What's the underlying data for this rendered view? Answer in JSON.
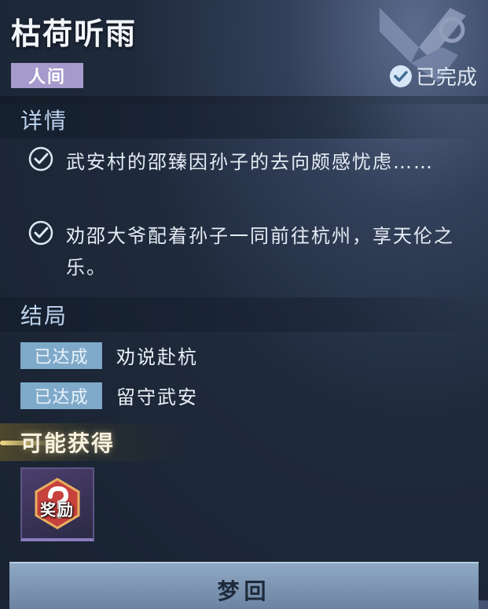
{
  "header": {
    "title": "枯荷听雨",
    "realm_tag": "人间",
    "status_label": "已完成"
  },
  "details": {
    "heading": "详情",
    "items": [
      {
        "text": "武安村的邵臻因孙子的去向颇感忧虑……",
        "completed": true
      },
      {
        "text": "劝邵大爷配着孙子一同前往杭州，享天伦之乐。",
        "completed": true
      }
    ]
  },
  "endings": {
    "heading": "结局",
    "items": [
      {
        "badge": "已达成",
        "text": "劝说赴杭"
      },
      {
        "badge": "已达成",
        "text": "留守武安"
      }
    ]
  },
  "rewards": {
    "heading": "可能获得",
    "items": [
      {
        "label": "奖励",
        "icon": "mystery-reward-icon"
      }
    ]
  },
  "actions": {
    "main_button": "梦回"
  },
  "colors": {
    "realm_tag_bg": "#a59acb",
    "badge_bg": "#7fa9c9",
    "section_title": "#bcd3ee",
    "button_bg": "#7f98b6"
  }
}
